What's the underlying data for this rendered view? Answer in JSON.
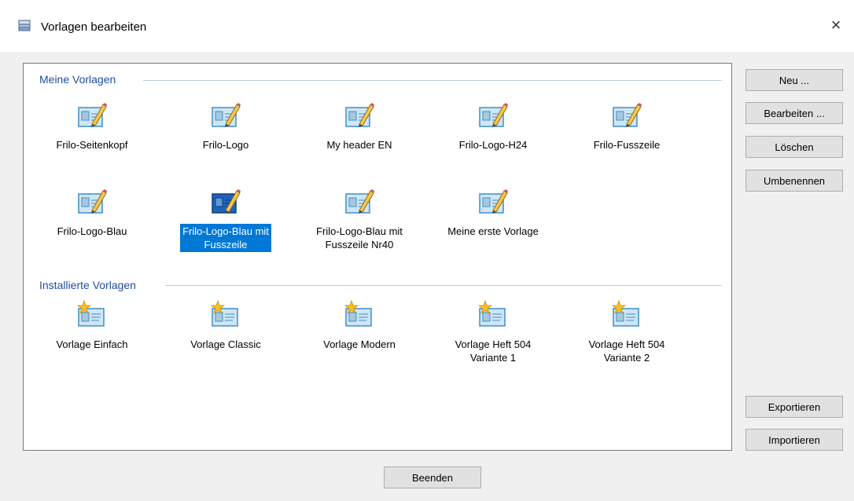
{
  "window": {
    "title": "Vorlagen bearbeiten",
    "close": "×"
  },
  "groups": {
    "own": {
      "heading": "Meine Vorlagen",
      "items": [
        {
          "label": "Frilo-Seitenkopf"
        },
        {
          "label": "Frilo-Logo"
        },
        {
          "label": "My header EN"
        },
        {
          "label": "Frilo-Logo-H24"
        },
        {
          "label": "Frilo-Fusszeile"
        },
        {
          "label": "Frilo-Logo-Blau"
        },
        {
          "label": "Frilo-Logo-Blau mit\nFusszeile",
          "selected": true
        },
        {
          "label": "Frilo-Logo-Blau mit\nFusszeile Nr40"
        },
        {
          "label": "Meine erste Vorlage"
        }
      ]
    },
    "installed": {
      "heading": "Installierte Vorlagen",
      "items": [
        {
          "label": "Vorlage Einfach"
        },
        {
          "label": "Vorlage Classic"
        },
        {
          "label": "Vorlage Modern"
        },
        {
          "label": "Vorlage Heft 504\nVariante 1"
        },
        {
          "label": "Vorlage Heft 504\nVariante 2"
        }
      ]
    }
  },
  "buttons": {
    "new": "Neu ...",
    "edit": "Bearbeiten ...",
    "delete": "Löschen",
    "rename": "Umbenennen",
    "export": "Exportieren",
    "import": "Importieren",
    "finish": "Beenden"
  },
  "colors": {
    "accent": "#0078d7",
    "group_heading": "#1e4fa0"
  }
}
